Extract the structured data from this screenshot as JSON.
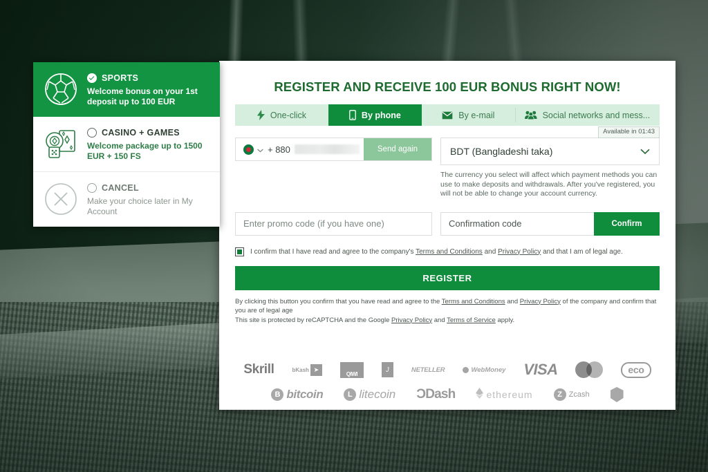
{
  "background": {
    "scene": "stadium-night-rain",
    "primary_color": "#143021"
  },
  "choice_panel": {
    "items": [
      {
        "id": "sports",
        "icon": "football-icon",
        "title": "SPORTS",
        "description": "Welcome bonus on your 1st deposit up to 100 EUR",
        "selected": true
      },
      {
        "id": "casino",
        "icon": "casino-chips-cards-icon",
        "title": "CASINO + GAMES",
        "description": "Welcome package up to 1500 EUR + 150 FS",
        "selected": false
      },
      {
        "id": "cancel",
        "icon": "cancel-x-icon",
        "title": "CANCEL",
        "description": "Make your choice later in My Account",
        "selected": false
      }
    ]
  },
  "card": {
    "title": "REGISTER AND RECEIVE 100 EUR BONUS RIGHT NOW!",
    "tabs": [
      {
        "id": "one-click",
        "label": "One-click",
        "icon": "lightning-bolt-icon",
        "active": false
      },
      {
        "id": "by-phone",
        "label": "By phone",
        "icon": "mobile-phone-icon",
        "active": true
      },
      {
        "id": "by-email",
        "label": "By e-mail",
        "icon": "envelope-icon",
        "active": false
      },
      {
        "id": "social",
        "label": "Social networks and mess...",
        "icon": "people-group-icon",
        "active": false
      }
    ],
    "phone": {
      "flag": "bangladesh-flag-icon",
      "country_code": "+ 880",
      "number_value": "",
      "number_masked": true,
      "send_again_label": "Send again",
      "tooltip": "Available in 01:43"
    },
    "currency": {
      "selected": "BDT (Bangladeshi taka)",
      "chevron": "chevron-down-icon",
      "hint": "The currency you select will affect which payment methods you can use to make deposits and withdrawals. After you've registered, you will not be able to change your account currency."
    },
    "promo": {
      "placeholder": "Enter promo code (if you have one)",
      "value": ""
    },
    "confirmation": {
      "placeholder": "Confirmation code",
      "value": "",
      "button_label": "Confirm"
    },
    "agreement": {
      "checked": true,
      "prefix": "I confirm that I have read and agree to the company's ",
      "link1": "Terms and Conditions",
      "mid": " and ",
      "link2": "Privacy Policy",
      "suffix": " and that I am of legal age."
    },
    "register_button": "REGISTER",
    "legal": {
      "line1_a": "By clicking this button you confirm that you have read and agree to the ",
      "line1_link1": "Terms and Conditions",
      "line1_b": " and ",
      "line1_link2": "Privacy Policy",
      "line1_c": " of the company and confirm that you are of legal age",
      "line2_a": "This site is protected by reCAPTCHA and the Google ",
      "line2_link1": "Privacy Policy",
      "line2_b": " and ",
      "line2_link2": "Terms of Service",
      "line2_c": " apply."
    }
  },
  "payments": {
    "row1": [
      {
        "id": "skrill",
        "label": "Skrill"
      },
      {
        "id": "bkash",
        "label": "bKash"
      },
      {
        "id": "qiwi",
        "label": "QIWI"
      },
      {
        "id": "jeton",
        "label": "Jeton"
      },
      {
        "id": "neteller",
        "label": "NETELLER"
      },
      {
        "id": "webmoney",
        "label": "WebMoney"
      },
      {
        "id": "visa",
        "label": "VISA"
      },
      {
        "id": "mastercard",
        "label": "Mastercard"
      },
      {
        "id": "ecopayz",
        "label": "eco"
      }
    ],
    "row2": [
      {
        "id": "bitcoin",
        "label": "bitcoin",
        "mark": "B"
      },
      {
        "id": "litecoin",
        "label": "litecoin",
        "mark": "L"
      },
      {
        "id": "dash",
        "label": "Dash"
      },
      {
        "id": "ethereum",
        "label": "ethereum"
      },
      {
        "id": "zcash",
        "label": "Zcash",
        "mark": "Z"
      },
      {
        "id": "nem",
        "label": "NEM"
      }
    ]
  },
  "colors": {
    "brand_green": "#0f8c3c",
    "title_green": "#1d6b2f",
    "tab_bar_bg": "#d6eedd",
    "muted_green": "#8cc79c"
  }
}
